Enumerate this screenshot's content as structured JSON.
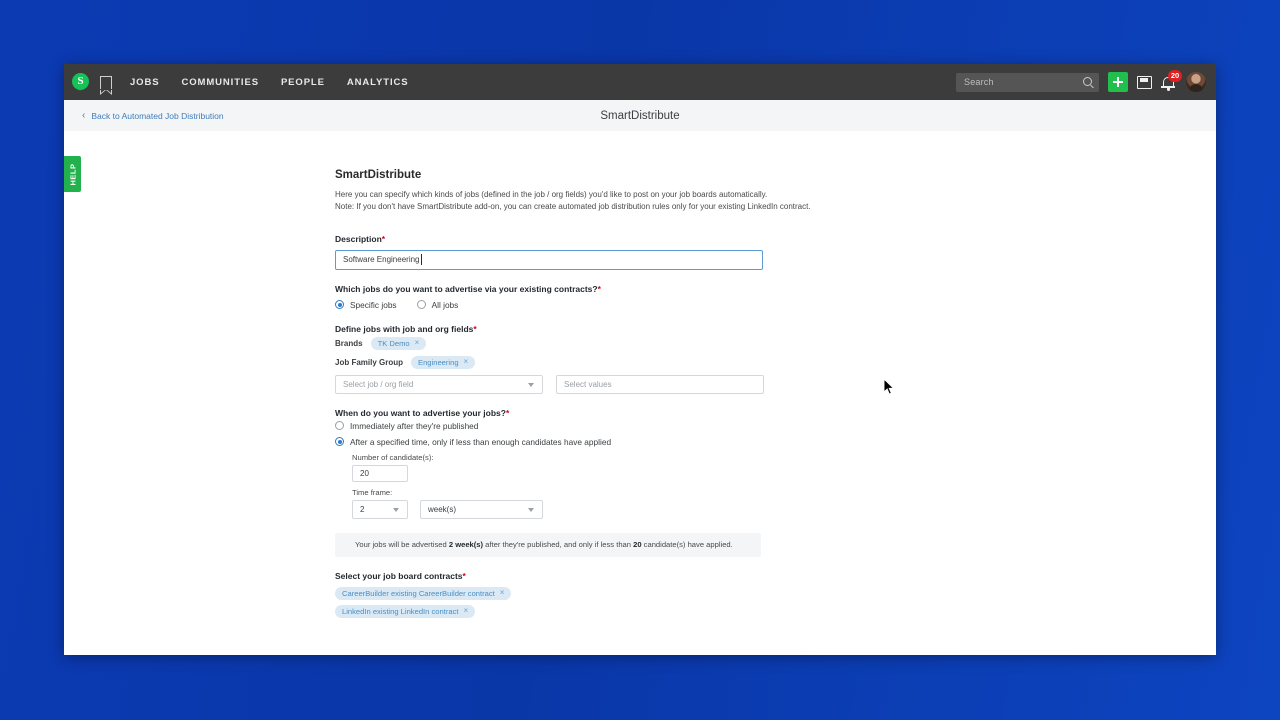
{
  "topnav": {
    "logo_letter": "S",
    "links": [
      "JOBS",
      "COMMUNITIES",
      "PEOPLE",
      "ANALYTICS"
    ],
    "search_placeholder": "Search",
    "notification_count": "20"
  },
  "subheader": {
    "back_label": "Back to Automated Job Distribution",
    "back_chevron": "‹",
    "title": "SmartDistribute"
  },
  "help_tab": {
    "label": "HELP"
  },
  "form": {
    "title": "SmartDistribute",
    "desc_line1": "Here you can specify which kinds of jobs (defined in the job / org fields) you'd like to post on your job boards automatically.",
    "desc_line2": "Note: If you don't have SmartDistribute add-on, you can create automated job distribution rules only for your existing LinkedIn contract.",
    "description": {
      "label": "Description",
      "required": "*",
      "value": "Software Engineering"
    },
    "which_jobs": {
      "label": "Which jobs do you want to advertise via your existing contracts?",
      "required": "*",
      "options": [
        {
          "label": "Specific jobs",
          "selected": true
        },
        {
          "label": "All jobs",
          "selected": false
        }
      ]
    },
    "define_jobs": {
      "label": "Define jobs with job and org fields",
      "required": "*",
      "rows": [
        {
          "key": "Brands",
          "chip": "TK Demo",
          "remove": "×"
        },
        {
          "key": "Job Family Group",
          "chip": "Engineering",
          "remove": "×"
        }
      ],
      "field_select_placeholder": "Select job / org field",
      "values_select_placeholder": "Select values"
    },
    "when": {
      "label": "When do you want to advertise your jobs?",
      "required": "*",
      "options": [
        {
          "label": "Immediately after they're published",
          "selected": false
        },
        {
          "label": "After a specified time, only if less than enough candidates have applied",
          "selected": true
        }
      ],
      "number_label": "Number of candidate(s):",
      "number_value": "20",
      "timeframe_label": "Time frame:",
      "timeframe_value": "2",
      "timeframe_unit": "week(s)",
      "note_prefix": "Your jobs will be advertised ",
      "note_bold1": "2 week(s)",
      "note_middle": " after they're published, and only if less than ",
      "note_bold2": "20",
      "note_suffix": " candidate(s) have applied."
    },
    "contracts": {
      "label": "Select your job board contracts",
      "required": "*",
      "chips": [
        {
          "label": "CareerBuilder existing CareerBuilder contract",
          "remove": "×"
        },
        {
          "label": "LinkedIn existing LinkedIn contract",
          "remove": "×"
        }
      ]
    }
  }
}
